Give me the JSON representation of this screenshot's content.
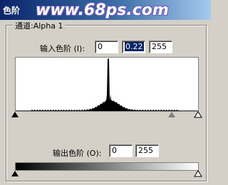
{
  "title": "色阶",
  "watermark": "www.68ps.com",
  "channel": {
    "label": "通道:Alpha 1"
  },
  "input_levels": {
    "label": "输入色阶 (I):",
    "values": [
      "0",
      "0.22",
      "255"
    ]
  },
  "output_levels": {
    "label": "输出色阶 (O):",
    "values": [
      "0",
      "255"
    ]
  },
  "histogram": {
    "color": "#000000",
    "shape": "sharp-peak-center",
    "input_slider_levels": [
      0,
      0.22,
      255
    ],
    "output_slider_levels": [
      0,
      255
    ]
  }
}
